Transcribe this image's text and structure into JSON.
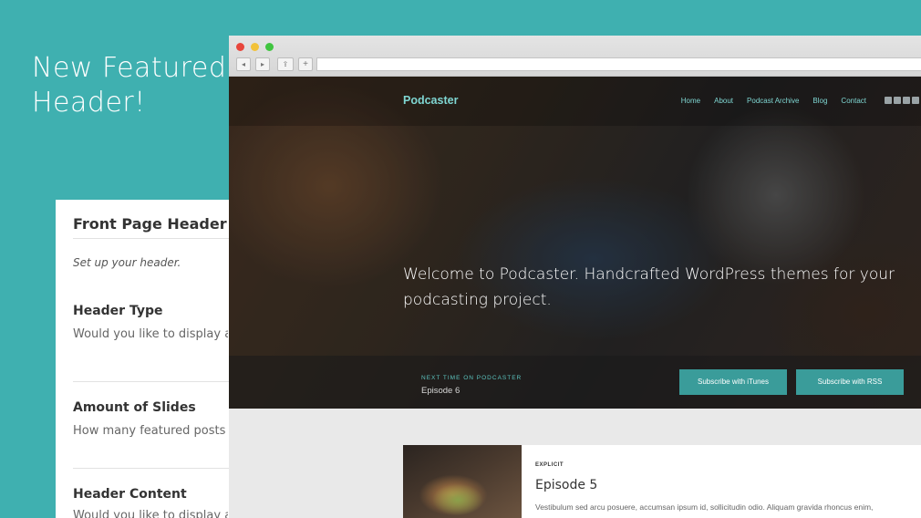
{
  "promo": {
    "title_line1": "New Featured",
    "title_line2": "Header!"
  },
  "settings": {
    "title": "Front Page Header",
    "subtitle": "Set up your header.",
    "sections": [
      {
        "heading": "Header Type",
        "desc": "Would you like to display a s"
      },
      {
        "heading": "Amount of Slides",
        "desc": "How many featured posts sh"
      },
      {
        "heading": "Header Content",
        "desc": "Would you like to display a f"
      }
    ]
  },
  "browser": {
    "back_icon": "◂",
    "forward_icon": "▸",
    "share_icon": "⇪",
    "add_icon": "+"
  },
  "site": {
    "brand": "Podcaster",
    "menu": [
      "Home",
      "About",
      "Podcast Archive",
      "Blog",
      "Contact"
    ],
    "social_icons": [
      "mail-icon",
      "facebook-icon",
      "twitter-icon",
      "instagram-icon"
    ],
    "headline": "Welcome to Podcaster. Handcrafted WordPress themes for your podcasting project.",
    "next_label": "NEXT TIME ON PODCASTER",
    "next_episode": "Episode 6",
    "subscribe_itunes": "Subscribe with iTunes",
    "subscribe_rss": "Subscribe with RSS"
  },
  "episode_card": {
    "tag": "EXPLICIT",
    "title": "Episode 5",
    "description": "Vestibulum sed arcu posuere, accumsan ipsum id, sollicitudin odio. Aliquam gravida rhoncus enim,"
  },
  "colors": {
    "background": "#3fb0b0",
    "accent": "#7fd6d2",
    "button": "#3a9c9a"
  }
}
